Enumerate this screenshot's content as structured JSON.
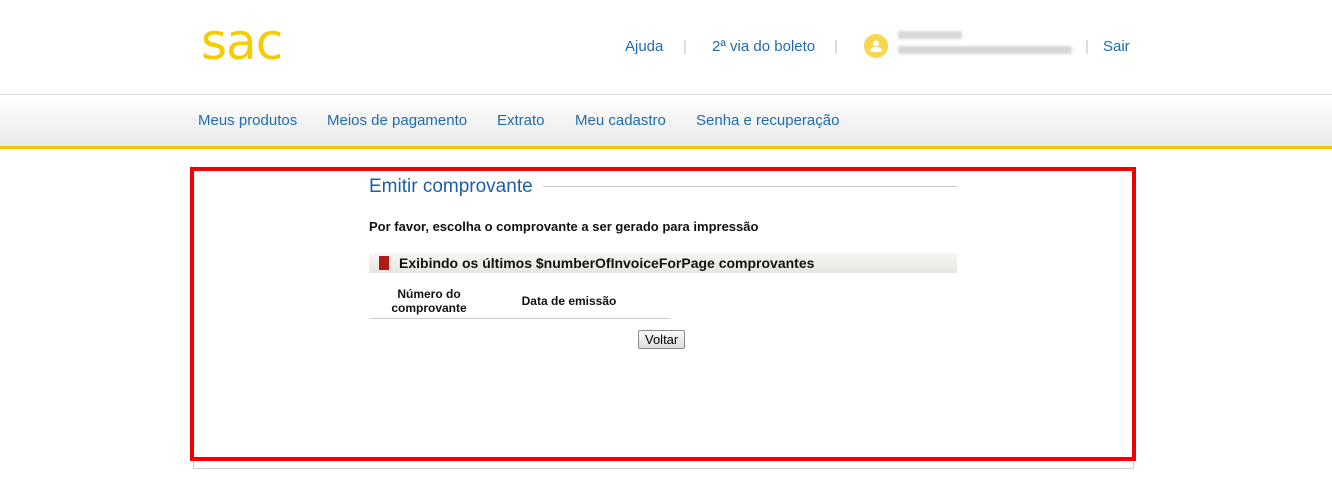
{
  "header": {
    "logo": "sac",
    "links": {
      "help": "Ajuda",
      "boleto": "2ª via do boleto",
      "logout": "Sair"
    },
    "separator": "|"
  },
  "nav": {
    "items": [
      {
        "label": "Meus produtos"
      },
      {
        "label": "Meios de pagamento"
      },
      {
        "label": "Extrato"
      },
      {
        "label": "Meu cadastro"
      },
      {
        "label": "Senha e recuperação"
      }
    ]
  },
  "content": {
    "title": "Emitir comprovante",
    "instruction": "Por favor, escolha o comprovante a ser gerado para impressão",
    "list_heading": "Exibindo os últimos $numberOfInvoiceForPage comprovantes",
    "table": {
      "headers": {
        "number_line1": "Número do",
        "number_line2": "comprovante",
        "date": "Data de emissão"
      },
      "rows": []
    },
    "back_button": "Voltar"
  },
  "colors": {
    "brand_yellow": "#f5cc00",
    "link_blue": "#1e6bb0",
    "highlight_red": "#f00000",
    "list_icon": "#b21a14"
  },
  "icons": {
    "avatar": "user-avatar-icon",
    "list_marker": "document-marker-icon"
  }
}
